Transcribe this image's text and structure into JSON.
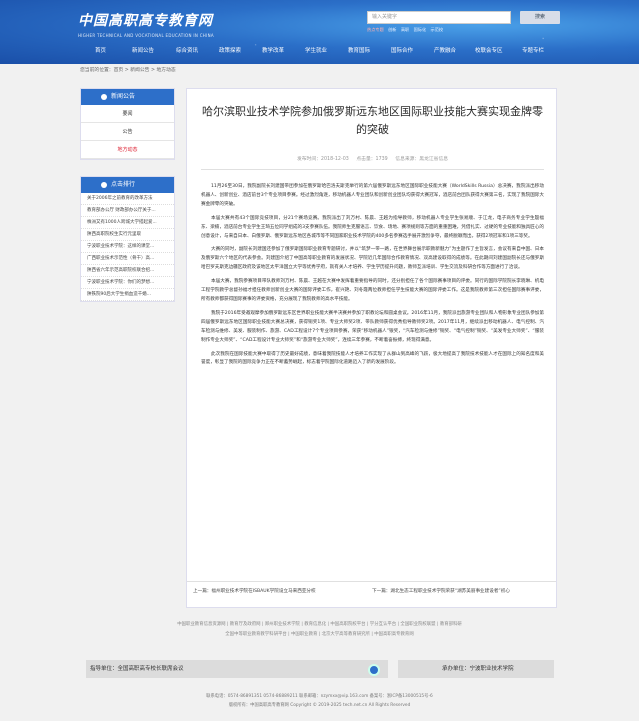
{
  "header": {
    "logo_cn": "中国高职高专教育网",
    "logo_en": "HIGHER TECHNICAL AND VOCATIONAL EDUCATION IN CHINA",
    "search_placeholder": "输入关键字",
    "search_button": "搜索",
    "hot_label": "热点专题",
    "hot_words": [
      "创新",
      "高职",
      "国际化",
      "示范校"
    ]
  },
  "nav": [
    "首页",
    "新闻公告",
    "综合资讯",
    "政策探索",
    "教学改革",
    "学生就业",
    "教育国际",
    "国际合作",
    "产教融合",
    "校联会专区",
    "专题专栏"
  ],
  "breadcrumb": "您当前的位置：首页 > 新闻公告 > 地方动态",
  "sidebar": {
    "news_title": "新闻公告",
    "news_items": [
      "要闻",
      "公告",
      "地方动态"
    ],
    "rank_title": "点击排行",
    "rank_items": [
      "关于2006年之前教育的改革方法",
      "教育部办公厅 财政部办公厅关于...",
      "株洲又有1000人跨城大学搭起爱...",
      "陕西高职院校生实行元里取",
      "宁波职业技术学院：这样的课堂...",
      "广西职业技术示范性（骨干）高...",
      "陕西省六年示范高职院校联合招...",
      "宁波职业技术学院：你们的梦想...",
      "陕铁院90后大学生捐血造千婚..."
    ]
  },
  "article": {
    "title": "哈尔滨职业技术学院参加俄罗斯远东地区国际职业技能大赛实现金牌零的突破",
    "meta": {
      "date": "发布时间：2018-12-03",
      "clicks": "点击量：1739",
      "source_label": "信息来源：黑龙江省信息"
    },
    "paragraphs": [
      "11月26至30日，我院副院长刘建国带团参加在俄罗斯哈巴洛夫斯克举行的第六届俄罗斯远东地区国际职业技能大赛（WorldSkills Russia）总决赛，我院派出移动机器人、创新创业、酒店前台3个专业项目参赛。经过激烈角逐，移动机器人专业团队和创新创业团队均获得大赛冠军，酒店前台团队获得大赛第三名，实现了我院国际大赛金牌零的突破。",
      "本届大赛共有43个国际竞技项目，分21个赛场竞赛。我院派出了刘万村、陈晨、王越为指导教师，移动机器人专业学生张易顺、于江龙，电子商务专业学生殷福东、梁楠，酒店前台专业学生王琦五位同学组成的3支参赛队伍。我院师生克服语言、饮食、场地、赛项规则等方面的重重困难，凭借扎实、过硬的专业技能和独具匠心的创意设计，与来自日本、白俄罗斯、俄罗斯远东地区各城市等不同国家职业技术学院的400多名参赛选手展开激烈争夺，最终脱颖而出，获得2项冠军和1项三等奖。",
      "大赛的同时，副院长刘建国还参加了俄罗斯国际职业教育专题研讨，并以“筑梦一带一路，在世界舞台展示职教新魅力”为主题作了主旨发言，会议有来自中国、日本及俄罗斯六个地区的代表参会。刘建国介绍了中国高等职业教育的发展状况、学院近几年国际合作教育情况、双高建设取得的成绩等。在此期间刘建国副院长还与俄罗斯哈巴罗夫斯克边疆区政府及该地区太平洋国立大学等优秀学府，就有关人才培养、学生学历提升问题，教师互派培训、学生交流及科研合作等方面进行了洽谈。",
      "本届大赛，我院参赛项目带队教师刘万村、陈晨、王越在大赛中发挥着重要指导的同时，还分别担任了各个国际赛事项目的评委。同行的国际学院院长李晓琳、机电工程学院教学总督孙福才担任教师创新创业大赛的国际评委工作，崔兴艳、刘冬霞两位教师担任学生技能大赛的国际评委工作。这是我院教师第三次担任国际赛事评委，所有教师都获得国际赛事的评委资格，充分展现了我院教师的高水平技能。",
      "我院于2016年受邀观摩参加俄罗斯远东区世界职业技能大赛半决赛并参加了职教论坛和圆桌会议。2016年11月，我院派出旅游专业团队和人物形象专业团队参加第四届俄罗斯远东地区国际职业技能大赛总决赛，获得铜奖1项、专业大师奖2项、带队教师获得优秀指导教师奖2项。2017年11月，继续派出移动机器人、电气控制、汽车检测与维修、美发、服装制作、旅游、CAD工程设计7个专业项目参赛，荣获“移动机器人”银奖，“汽车检测与维修”铜奖、“电气控制”铜奖、“美发专业大师奖”、“服装制作专业大师奖”、“CAD工程设计专业大师奖”和“旅游专业大师奖”，连续三年参赛，不断着奋振搏，终现得满意。",
      "此次我院在国际技能大赛中取得了历史最好成绩，意味着我院技能人才培养工作实现了从群山到高峰的飞跃，极大地提高了我院技术技能人才在国际上的知名度和美誉度，彰显了我院的国际竞争力正在不断蓄势崛起，标志着学院国际化道路迈入了新的发展阶段。"
    ],
    "prev": "上一篇：福州职业技术学院在ISBAUK学院设立马来西亚分校",
    "next": "下一篇：湖北生态工程职业技术学院荣获“湖苏美丽事业建设者”初心"
  },
  "footer": {
    "links_line1": "中国职业教育信息资源网 | 教育厅及政府网 | 郑州职业技术学院 | 教育信息化 | 中国高职院校平台 | 学分互认平台 | 全国职业院校联盟 | 教育部科研",
    "links_line2": "全国中等职业教育教学科研平台 | 中国职业教育 | 北京大学高等教育研究所 | 中国高职高专教育网",
    "org_left": "指导单位：全国高职高专校长联席会议",
    "org_right": "承办单位：宁波职业技术学院",
    "contact": "联系电话：0574-86891351 0574-86889211  联系邮箱：nzymxx@vip.163.com  备案号：浙ICP备13000515号-6",
    "copyright": "版权所有：中国高职高专教育网 Copyright © 2019-2025 tech.net.cn All Rights Reserved"
  }
}
